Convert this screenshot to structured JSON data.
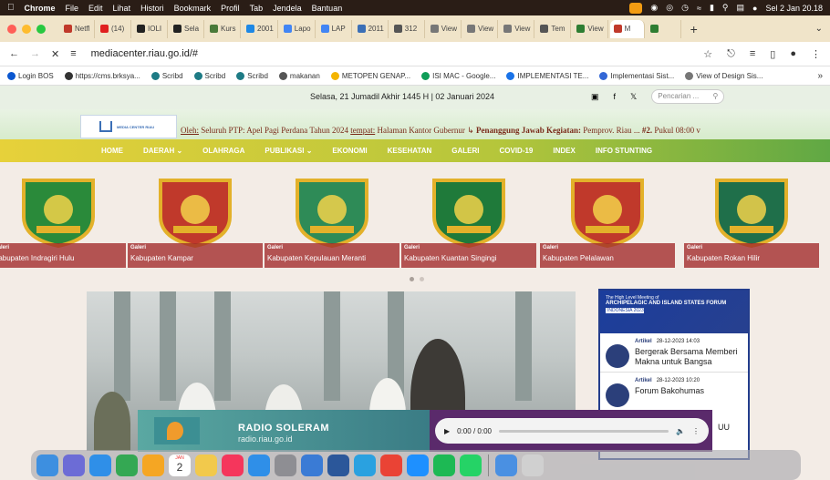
{
  "menubar": {
    "app": "Chrome",
    "menus": [
      "File",
      "Edit",
      "Lihat",
      "Histori",
      "Bookmark",
      "Profil",
      "Tab",
      "Jendela",
      "Bantuan"
    ],
    "clock": "Sel 2 Jan 20.18"
  },
  "tabs": [
    {
      "label": "Netfl",
      "color": "#c0392b"
    },
    {
      "label": "(14)",
      "color": "#e02020"
    },
    {
      "label": "IOLI",
      "color": "#222222"
    },
    {
      "label": "Sela",
      "color": "#222222"
    },
    {
      "label": "Kurs",
      "color": "#4a7a3a"
    },
    {
      "label": "2001",
      "color": "#1e88e5"
    },
    {
      "label": "Lapo",
      "color": "#4285f4"
    },
    {
      "label": "LAP",
      "color": "#4285f4"
    },
    {
      "label": "2011",
      "color": "#3b6fb6"
    },
    {
      "label": "312",
      "color": "#555555"
    },
    {
      "label": "View",
      "color": "#777777"
    },
    {
      "label": "View",
      "color": "#777777"
    },
    {
      "label": "View",
      "color": "#777777"
    },
    {
      "label": "Tem",
      "color": "#555555"
    },
    {
      "label": "View",
      "color": "#2e7d32"
    },
    {
      "label": "M",
      "color": "#c0392b"
    },
    {
      "label": "",
      "color": "#2e7d32"
    }
  ],
  "address": {
    "url": "mediacenter.riau.go.id/#"
  },
  "bookmarks": [
    {
      "label": "Login BOS",
      "color": "#0b57d0"
    },
    {
      "label": "https://cms.brksya...",
      "color": "#333333"
    },
    {
      "label": "Scribd",
      "color": "#1e7b85"
    },
    {
      "label": "Scribd",
      "color": "#1e7b85"
    },
    {
      "label": "Scribd",
      "color": "#1e7b85"
    },
    {
      "label": "makanan",
      "color": "#555555"
    },
    {
      "label": "METOPEN GENAP...",
      "color": "#f4b400"
    },
    {
      "label": "ISI MAC - Google...",
      "color": "#0f9d58"
    },
    {
      "label": "IMPLEMENTASI TE...",
      "color": "#1a73e8"
    },
    {
      "label": "Implementasi Sist...",
      "color": "#3367d6"
    },
    {
      "label": "View of Design Sis...",
      "color": "#777777"
    }
  ],
  "page": {
    "date": "Selasa, 21 Jumadil Akhir 1445 H | 02 Januari 2024",
    "search_placeholder": "Pencarian ...",
    "logo_text": "MEDIA CENTER RIAU",
    "ticker": {
      "lead": "Oleh:",
      "text1": " Seluruh PTP: Apel Pagi Perdana Tahun 2024 ",
      "place_label": "tempat:",
      "text2": " Halaman Kantor Gubernur ↳ ",
      "resp_label": "Penanggung Jawab Kegiatan:",
      "text3": " Pemprov. Riau ... ",
      "text4": "#2.",
      "text5": " Pukul 08:00 v"
    },
    "nav": [
      "HOME",
      "DAERAH ⌄",
      "OLAHRAGA",
      "PUBLIKASI ⌄",
      "EKONOMI",
      "KESEHATAN",
      "GALERI",
      "COVID-19",
      "INDEX",
      "INFO STUNTING"
    ],
    "carousel": [
      {
        "tag": "Galeri",
        "name": "Kabupaten Indragiri Hulu",
        "color": "#2a8a3a"
      },
      {
        "tag": "Galeri",
        "name": "Kabupaten Kampar",
        "color": "#c0392b"
      },
      {
        "tag": "Galeri",
        "name": "Kabupaten Kepulauan Meranti",
        "color": "#2e8b57"
      },
      {
        "tag": "Galeri",
        "name": "Kabupaten Kuantan Singingi",
        "color": "#1f7a3a"
      },
      {
        "tag": "Galeri",
        "name": "Kabupaten Pelalawan",
        "color": "#c0392b"
      },
      {
        "tag": "Galeri",
        "name": "Kabupaten Rokan Hilir",
        "color": "#1f6f4a"
      }
    ],
    "sidebar": {
      "banner_small": "The High Level Meeting of",
      "banner_title": "ARCHIPELAGIC AND ISLAND STATES FORUM",
      "banner_sub": "INDONESIA 2023",
      "articles": [
        {
          "type": "Artikel",
          "date": "28-12-2023 14:03",
          "title": "Bergerak Bersama Memberi Makna untuk Bangsa"
        },
        {
          "type": "Artikel",
          "date": "28-12-2023 10:20",
          "title": "Forum Bakohumas"
        }
      ]
    },
    "radio": {
      "name": "RADIO SOLERAM",
      "url": "radio.riau.go.id",
      "time": "0:00 / 0:00"
    },
    "side_fragment": "UU"
  },
  "dock": [
    {
      "name": "finder-icon",
      "color": "#3d8fe0"
    },
    {
      "name": "launchpad-icon",
      "color": "#6c6cd6"
    },
    {
      "name": "safari-icon",
      "color": "#2f8fe8"
    },
    {
      "name": "chrome-icon",
      "color": "#34a853"
    },
    {
      "name": "photos-icon",
      "color": "#f5a623"
    },
    {
      "name": "calendar-icon",
      "color": "#ffffff"
    },
    {
      "name": "notes-icon",
      "color": "#f2c94c"
    },
    {
      "name": "music-icon",
      "color": "#f5365c"
    },
    {
      "name": "appstore-icon",
      "color": "#2f8fe8"
    },
    {
      "name": "settings-icon",
      "color": "#8e8e93"
    },
    {
      "name": "keynote-icon",
      "color": "#3a7bd5"
    },
    {
      "name": "word-icon",
      "color": "#2b579a"
    },
    {
      "name": "telegram-icon",
      "color": "#2aa1e0"
    },
    {
      "name": "chrome2-icon",
      "color": "#ea4335"
    },
    {
      "name": "bluesky-icon",
      "color": "#1e90ff"
    },
    {
      "name": "spotify-icon",
      "color": "#1db954"
    },
    {
      "name": "whatsapp-icon",
      "color": "#25d366"
    },
    {
      "name": "preview-icon",
      "color": "#4a90e2"
    },
    {
      "name": "trash-icon",
      "color": "#d0d0d0"
    }
  ],
  "calendar_day": "2",
  "calendar_month": "JAN"
}
